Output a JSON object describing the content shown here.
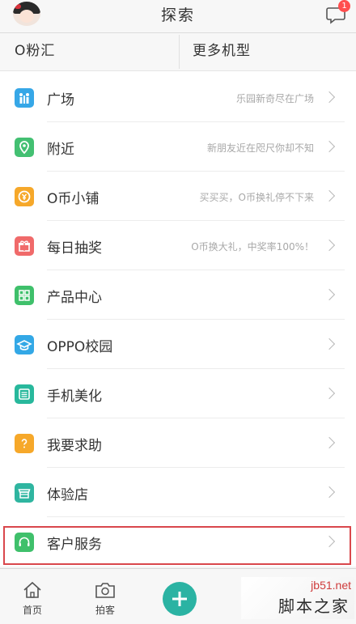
{
  "header": {
    "title": "探索",
    "badge": "1"
  },
  "tabs": {
    "left": "O粉汇",
    "right": "更多机型"
  },
  "menu": {
    "items": [
      {
        "label": "广场",
        "desc": "乐园新奇尽在广场",
        "color": "#36a7e7",
        "icon": "plaza-icon"
      },
      {
        "label": "附近",
        "desc": "新朋友近在咫尺你却不知",
        "color": "#43c072",
        "icon": "location-pin-icon"
      },
      {
        "label": "O币小铺",
        "desc": "买买买，O币换礼停不下来",
        "color": "#f6a82a",
        "icon": "coin-icon"
      },
      {
        "label": "每日抽奖",
        "desc": "O币换大礼，中奖率100%！",
        "color": "#f06a6a",
        "icon": "gift-icon"
      },
      {
        "label": "产品中心",
        "desc": "",
        "color": "#3fc06b",
        "icon": "grid-icon"
      },
      {
        "label": "OPPO校园",
        "desc": "",
        "color": "#33a8e6",
        "icon": "graduation-cap-icon"
      },
      {
        "label": "手机美化",
        "desc": "",
        "color": "#28b89c",
        "icon": "theme-icon"
      },
      {
        "label": "我要求助",
        "desc": "",
        "color": "#f6a82a",
        "icon": "question-icon"
      },
      {
        "label": "体验店",
        "desc": "",
        "color": "#2fb5a0",
        "icon": "store-icon"
      },
      {
        "label": "客户服务",
        "desc": "",
        "color": "#3fc06b",
        "icon": "headset-icon"
      }
    ]
  },
  "bottom_nav": {
    "home_label": "首页",
    "photo_label": "拍客"
  },
  "watermark": {
    "url": "jb51.net",
    "name": "脚本之家"
  }
}
